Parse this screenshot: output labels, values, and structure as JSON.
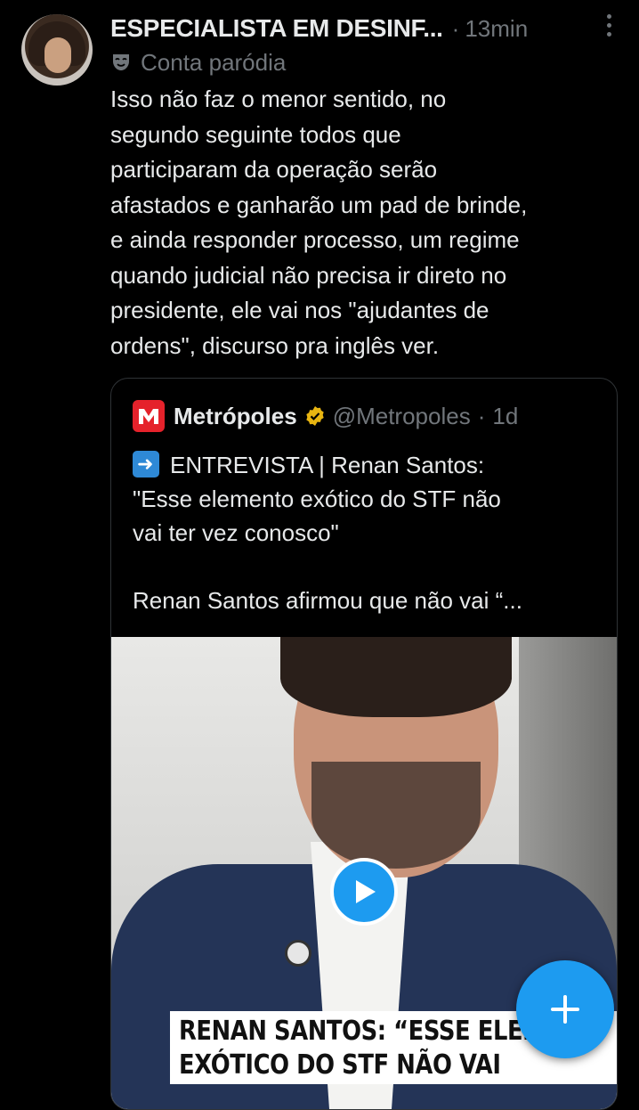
{
  "post": {
    "author_name": "ESPECIALISTA EM DESINF...",
    "time": "13min",
    "badge_label": "Conta paródia",
    "text": "Isso não faz o menor sentido, no\nsegundo seguinte todos que\nparticiparam da operação serão\nafastados e ganharão um pad de brinde,\ne ainda responder processo, um regime\nquando judicial não precisa ir direto no\npresidente, ele vai nos \"ajudantes de\nordens\", discurso pra inglês ver."
  },
  "quote": {
    "name": "Metrópoles",
    "handle": "@Metropoles",
    "time": "1d",
    "text": "ENTREVISTA | Renan Santos:\n\"Esse elemento exótico do STF não\nvai ter vez conosco\"\n\nRenan Santos afirmou que não vai “...",
    "video_caption_line1": "RENAN SANTOS: “ESSE ELEMEN",
    "video_caption_line2": "EXÓTICO DO STF NÃO VAI"
  },
  "icons": {
    "more": "more-vertical-icon",
    "parody": "theater-mask-icon",
    "verified": "verified-badge-icon",
    "play": "play-icon",
    "compose": "plus-icon"
  },
  "colors": {
    "background": "#000000",
    "text": "#e7e9ea",
    "muted": "#71767b",
    "accent": "#1d9bf0",
    "brand_red": "#e5222b",
    "verified_gold": "#e8b511"
  }
}
